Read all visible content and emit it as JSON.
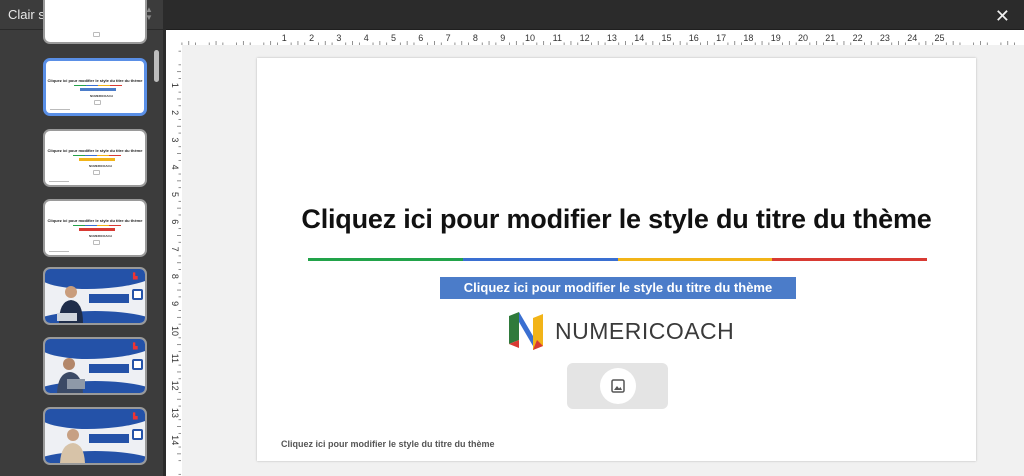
{
  "sidebar": {
    "theme_name": "Clair simple",
    "chevrons": "⌃⌄",
    "thumb_title": "Cliquez ici pour modifier le style du titre du thème",
    "thumb_logo": "NUMERICOACH"
  },
  "toolbar": {
    "close_icon": "✕"
  },
  "ruler": {
    "horizontal": [
      "1",
      "2",
      "3",
      "4",
      "5",
      "6",
      "7",
      "8",
      "9",
      "10",
      "11",
      "12",
      "13",
      "14",
      "15",
      "16",
      "17",
      "18",
      "19",
      "20",
      "21",
      "22",
      "23",
      "24",
      "25"
    ],
    "vertical": [
      "1",
      "2",
      "3",
      "4",
      "5",
      "6",
      "7",
      "8",
      "9",
      "10",
      "11",
      "12",
      "13",
      "14"
    ]
  },
  "slide": {
    "title": "Cliquez ici pour modifier le style du titre du thème",
    "subtitle": "Cliquez ici pour modifier le style du titre du thème",
    "logo_text": "NUMERICOACH",
    "footer": "Cliquez ici pour modifier le style du titre du thème",
    "line_colors": [
      "#22a34a",
      "#3a6fd1",
      "#f2b418",
      "#d83a33"
    ],
    "image_placeholder_icon": "image-icon"
  },
  "colors": {
    "accent": "#4b7cc9",
    "selected_border": "#5a8fe6",
    "dark_bg": "#2b2b2b"
  }
}
